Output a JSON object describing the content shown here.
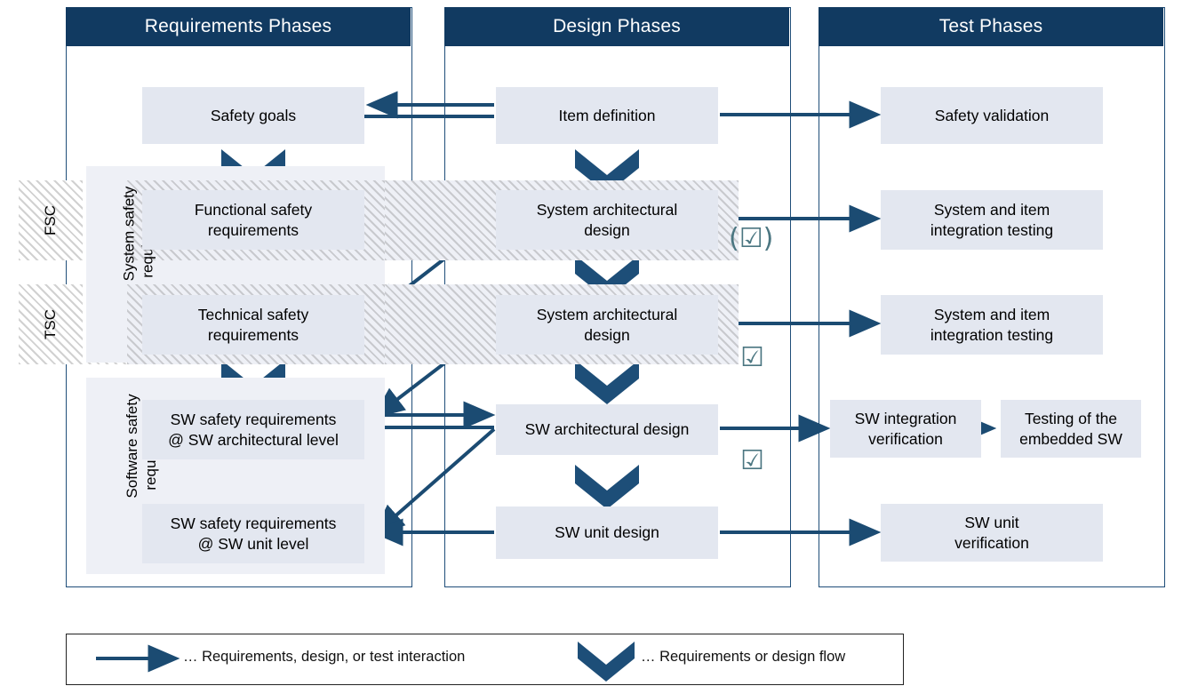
{
  "columns": [
    {
      "key": "requirements",
      "title": "Requirements Phases"
    },
    {
      "key": "design",
      "title": "Design Phases"
    },
    {
      "key": "test",
      "title": "Test Phases"
    }
  ],
  "side_labels": [
    {
      "id": "fsc",
      "label": "FSC"
    },
    {
      "id": "tsc",
      "label": "TSC"
    }
  ],
  "groups": [
    {
      "id": "system-safety-requirements",
      "label": "System safety\nrequirements"
    },
    {
      "id": "software-safety-requirements",
      "label": "Software safety\nrequirements"
    }
  ],
  "requirements_boxes": [
    {
      "id": "safety-goals",
      "label": "Safety goals"
    },
    {
      "id": "functional-safety-req",
      "label": "Functional safety\nrequirements"
    },
    {
      "id": "technical-safety-req",
      "label": "Technical safety\nrequirements"
    },
    {
      "id": "sw-safety-req-arch",
      "label": "SW safety requirements\n@ SW architectural level"
    },
    {
      "id": "sw-safety-req-unit",
      "label": "SW safety requirements\n@ SW unit level"
    }
  ],
  "design_boxes": [
    {
      "id": "item-definition",
      "label": "Item definition"
    },
    {
      "id": "system-arch-design-fsc",
      "label": "System architectural\ndesign"
    },
    {
      "id": "system-arch-design-tsc",
      "label": "System architectural\ndesign"
    },
    {
      "id": "sw-arch-design",
      "label": "SW architectural design"
    },
    {
      "id": "sw-unit-design",
      "label": "SW unit design"
    }
  ],
  "test_boxes": [
    {
      "id": "safety-validation",
      "label": "Safety validation"
    },
    {
      "id": "system-item-int-test-1",
      "label": "System and item\nintegration testing"
    },
    {
      "id": "system-item-int-test-2",
      "label": "System and item\nintegration testing"
    },
    {
      "id": "sw-integration-verif",
      "label": "SW integration\nverification"
    },
    {
      "id": "testing-embedded-sw",
      "label": "Testing of the\nembedded SW"
    },
    {
      "id": "sw-unit-verification",
      "label": "SW unit\nverification"
    }
  ],
  "checkmarks": [
    {
      "id": "checkmark-optional-system-arch-fsc",
      "label": "(☑)"
    },
    {
      "id": "checkmark-system-arch-tsc",
      "label": "☑"
    },
    {
      "id": "checkmark-sw-arch",
      "label": "☑"
    }
  ],
  "legend": {
    "arrow_text": "… Requirements, design, or test interaction",
    "chevron_text": "… Requirements or design flow"
  },
  "colors": {
    "header_blue": "#113a61",
    "box_fill": "#e3e7f0",
    "group_fill": "#eef0f6",
    "connector_blue": "#1b4b72",
    "chevron_blue": "#1d4e78",
    "checkmark_teal": "#4b7681",
    "frame_blue": "#1f4e79"
  }
}
